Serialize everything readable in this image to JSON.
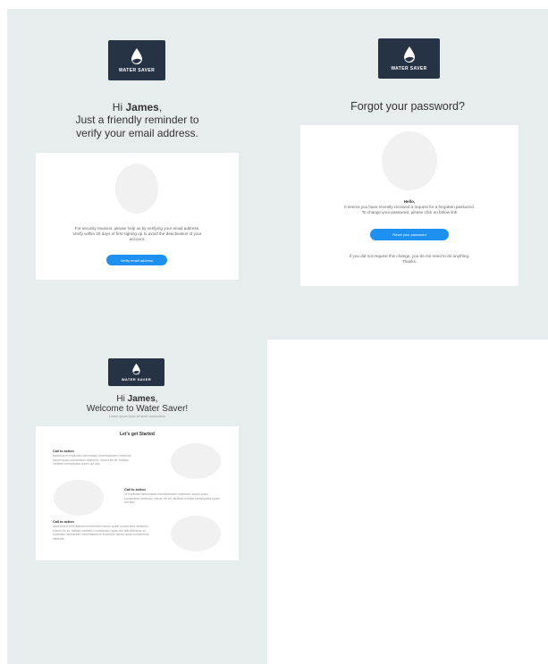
{
  "brand": {
    "name": "WATER SAVER",
    "color": "#263344",
    "accent": "#1e90f0"
  },
  "verify_email": {
    "greeting_prefix": "Hi ",
    "user_name": "James",
    "greeting_suffix": ",",
    "line1": "Just a friendly reminder to",
    "line2": "verify your email address.",
    "body_line1": "For security reasons, please help us by verifying your email address.",
    "body_line2": "Verify within 28 days of first signing up to avoid the deactivation of your",
    "body_line3": "account.",
    "button_label": "Verify email address"
  },
  "forgot_password": {
    "title": "Forgot your password?",
    "hello": "Hello,",
    "line1": "It seems you have recently received a request for a forgotten password.",
    "line2": "To change your password, please click on below link",
    "button_label": "Reset your password",
    "footer1": "If you did not request this change, you do not need to do anything.",
    "footer2": "Thanks."
  },
  "welcome": {
    "greeting_prefix": "Hi ",
    "user_name": "James",
    "greeting_suffix": ",",
    "title": "Welcome to Water Saver!",
    "subtitle": "Lorem ipsum dolor sit amet consectetur",
    "section_title": "Let's get Started",
    "ctas": [
      {
        "title": "Call to action",
        "body": "Maximus et explicabo laboriosam exercitationem inventore harum quasi consectetur distinctio, earum illo sit, facilisis veritatis consequatur quam aut alia"
      },
      {
        "title": "Call to action",
        "body": "Ut explicabo laboriosam exercitationem inventore harum quasi consectetur distinctio, earum illo sit, facilisis veritatis consequatur quam aut alia"
      },
      {
        "title": "Call to action",
        "body": "laboriosam exercitationem inventore harum quasi consectetur distinctio, earum illo sit, facilisis veritatis consequatur quam aut alia Maximus et explicabo laboriosam exercitationem inventore harum quasi consectetur distinctio"
      }
    ]
  }
}
